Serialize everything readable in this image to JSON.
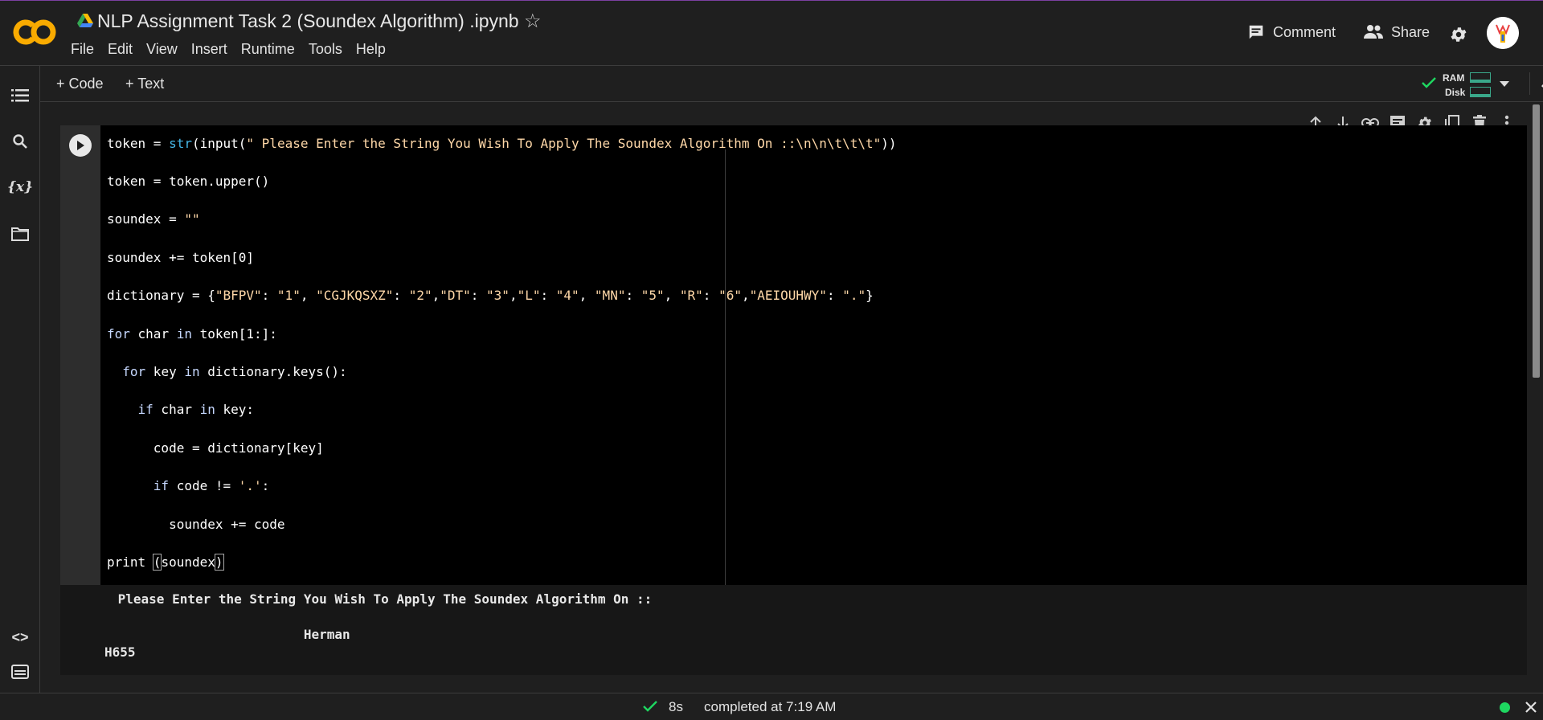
{
  "header": {
    "title": "NLP Assignment Task 2 (Soundex Algorithm) .ipynb",
    "logo_text": "CO",
    "menu": [
      "File",
      "Edit",
      "View",
      "Insert",
      "Runtime",
      "Tools",
      "Help"
    ],
    "comment_label": "Comment",
    "share_label": "Share"
  },
  "toolbar": {
    "code_label": "+ Code",
    "text_label": "+ Text",
    "ram_label": "RAM",
    "disk_label": "Disk"
  },
  "cell": {
    "code_lines": [
      "token = str(input(\" Please Enter the String You Wish To Apply The Soundex Algorithm On ::\\n\\n\\t\\t\\t\"))",
      "token = token.upper()",
      "soundex = \"\"",
      "soundex += token[0]",
      "dictionary = {\"BFPV\": \"1\", \"CGJKQSXZ\": \"2\",\"DT\": \"3\",\"L\": \"4\", \"MN\": \"5\", \"R\": \"6\",\"AEIOUHWY\": \".\"}",
      "for char in token[1:]:",
      "  for key in dictionary.keys():",
      "    if char in key:",
      "      code = dictionary[key]",
      "      if code != '.':",
      "        soundex += code",
      "print (soundex)"
    ],
    "output_lines": [
      " Please Enter the String You Wish To Apply The Soundex Algorithm On ::",
      "                         Herman",
      "H655"
    ]
  },
  "status": {
    "duration": "8s",
    "completed": "completed at 7:19 AM"
  },
  "colors": {
    "accent_green": "#1ed760",
    "logo_orange": "#f9ab00"
  }
}
